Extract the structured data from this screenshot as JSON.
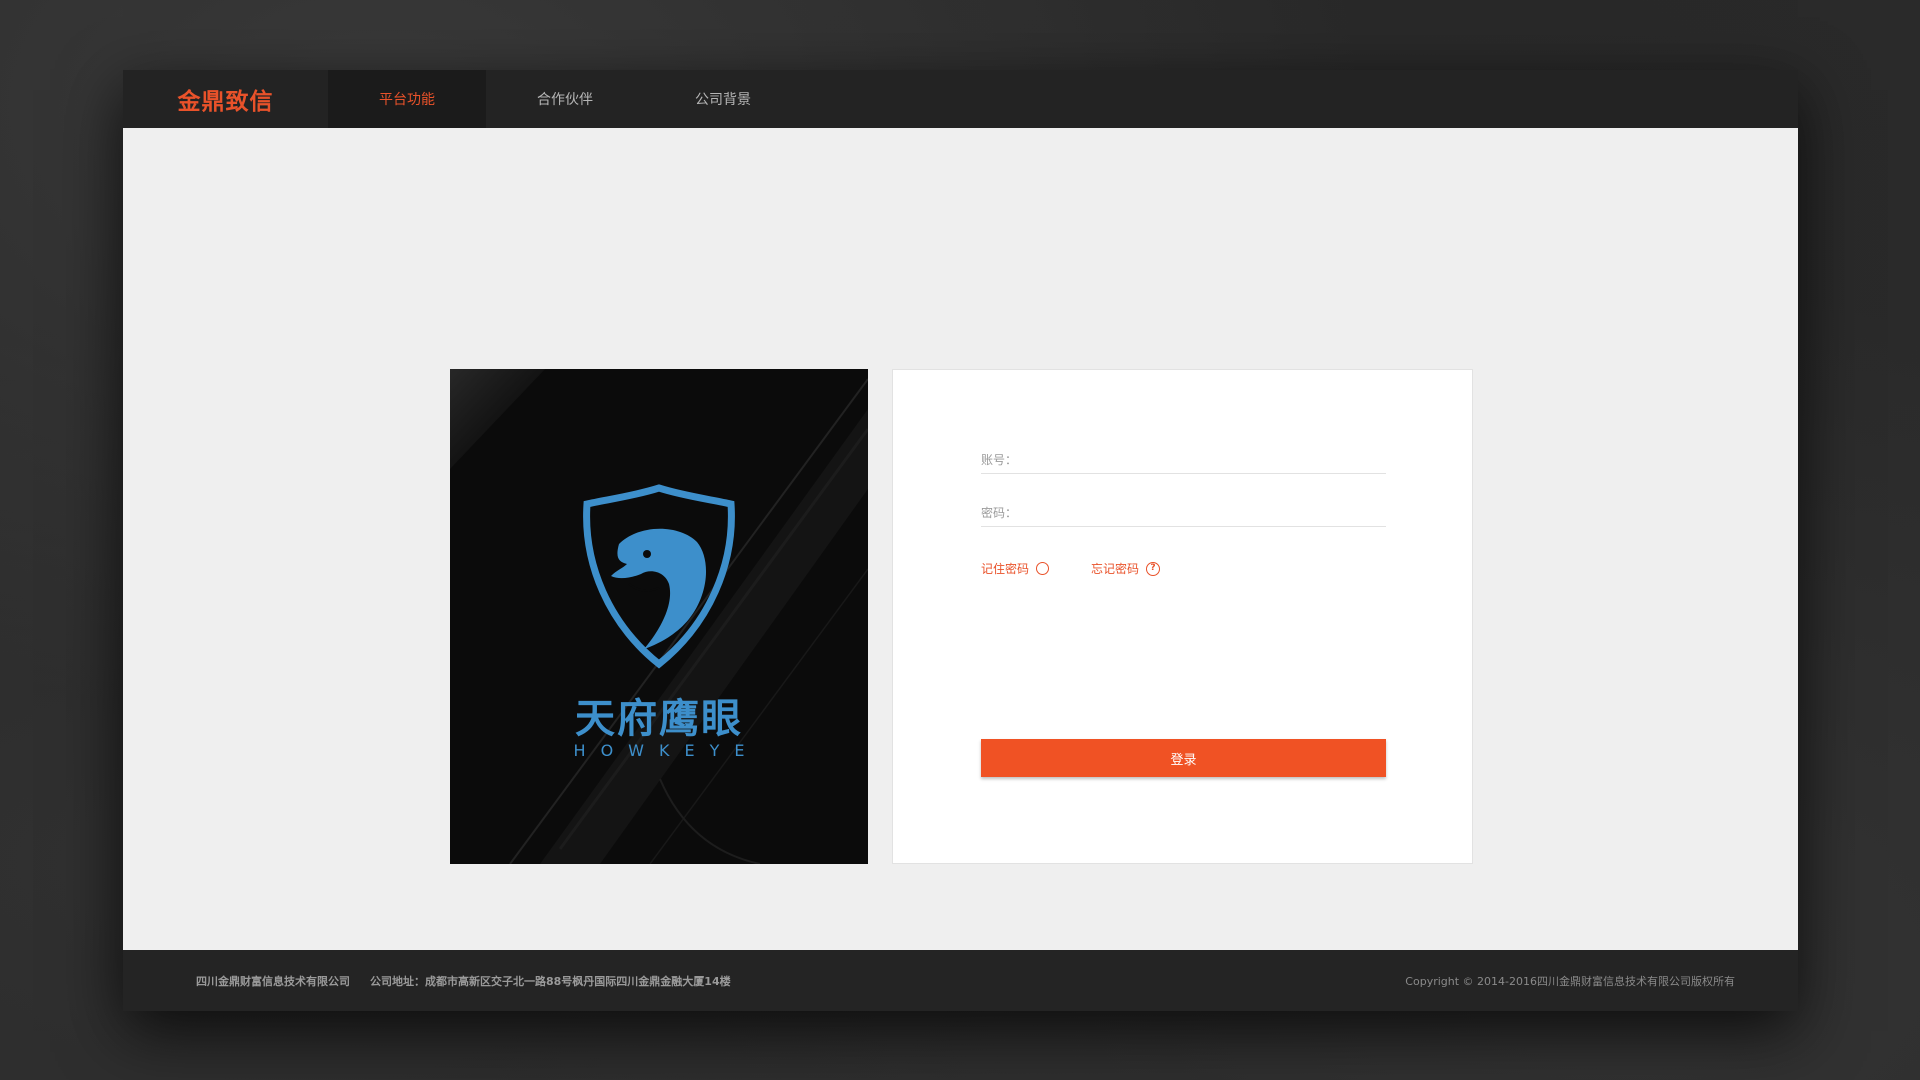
{
  "nav": {
    "brand": "金鼎致信",
    "items": [
      {
        "label": "平台功能"
      },
      {
        "label": "合作伙伴"
      },
      {
        "label": "公司背景"
      }
    ]
  },
  "hero": {
    "title": "天府鹰眼",
    "subtitle": "HOWKEYE",
    "icon": "eagle-shield-logo",
    "accent_color": "#3d8fcb"
  },
  "login": {
    "account_label": "账号：",
    "password_label": "密码：",
    "remember_label": "记住密码",
    "forgot_label": "忘记密码",
    "forgot_icon": "?",
    "submit_label": "登录",
    "accent_color": "#f05224"
  },
  "footer": {
    "company": "四川金鼎财富信息技术有限公司",
    "address": "公司地址：成都市高新区交子北一路88号枫丹国际四川金鼎金融大厦14楼",
    "copyright": "Copyright © 2014-2016四川金鼎财富信息技术有限公司版权所有"
  }
}
